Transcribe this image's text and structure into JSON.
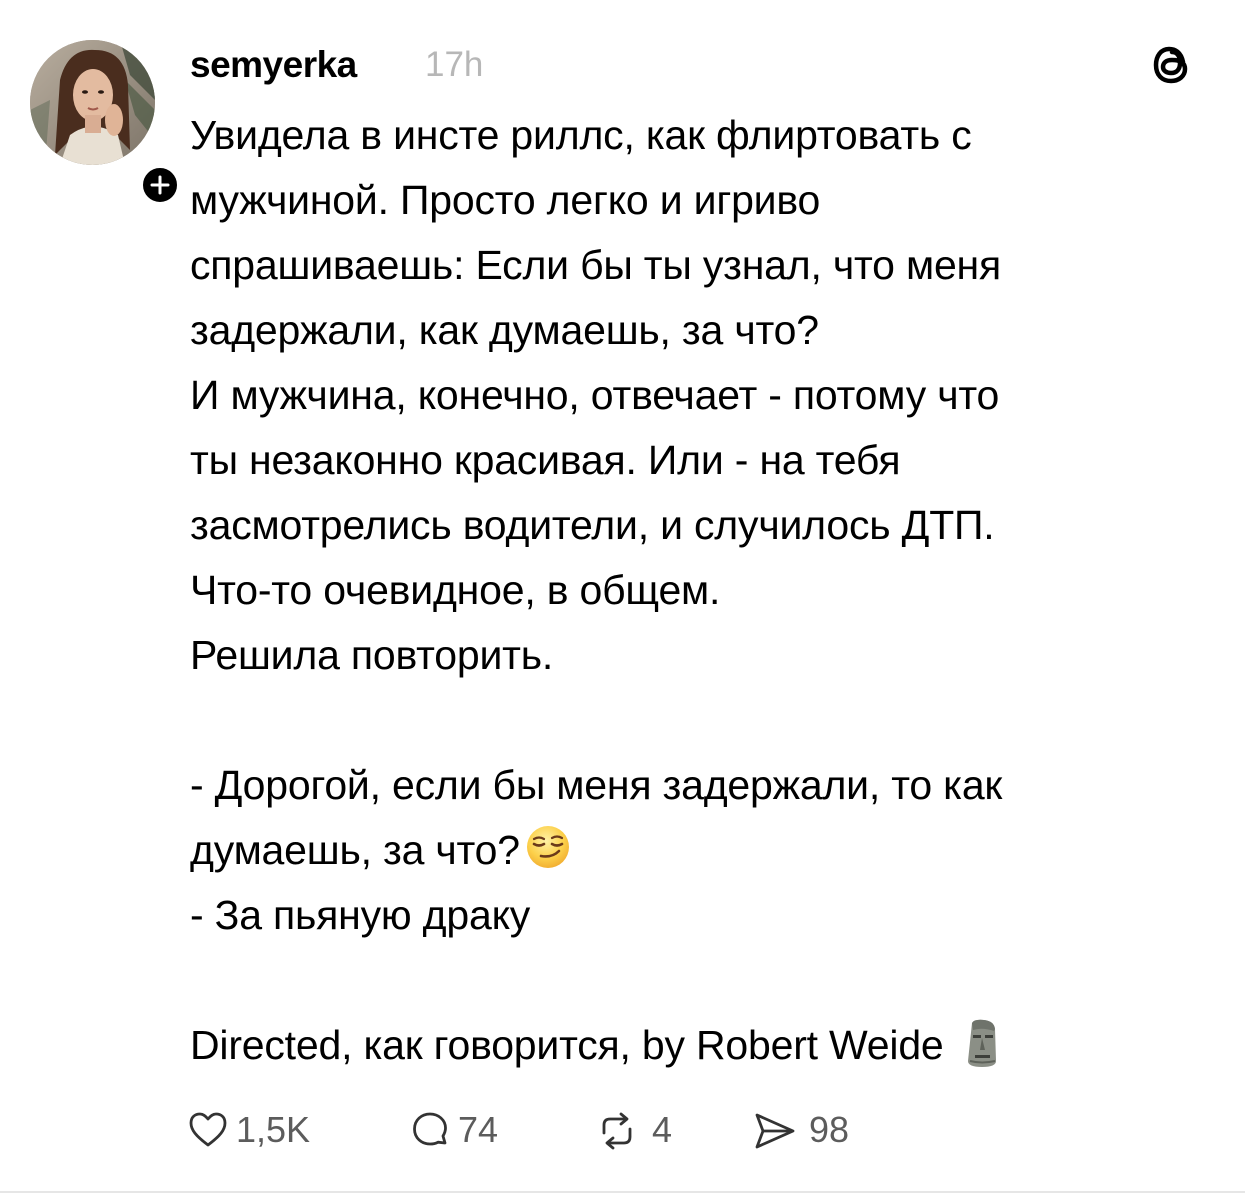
{
  "post": {
    "username": "semyerka",
    "timestamp": "17h",
    "lines": [
      "Увидела в инсте риллс, как флиртовать с",
      "мужчиной. Просто легко и игриво",
      "спрашиваешь: Если бы ты узнал, что меня",
      "задержали, как думаешь, за что?",
      "И мужчина, конечно, отвечает - потому что",
      "ты незаконно красивая. Или - на тебя",
      "засмотрелись водители, и случилось ДТП.",
      "Что-то очевидное, в общем.",
      "Решила повторить.",
      "",
      "- Дорогой, если бы меня задержали, то как",
      "думаешь, за что?",
      "- За пьяную драку",
      "",
      "Directed, как говорится, by Robert Weide"
    ],
    "emoji_line_11": "smirking-face-emoji",
    "emoji_line_14": "moai-emoji"
  },
  "actions": {
    "likes": "1,5K",
    "comments": "74",
    "reposts": "4",
    "shares": "98"
  },
  "icons": {
    "like": "heart-icon",
    "comment": "speech-bubble-icon",
    "repost": "repost-arrows-icon",
    "share": "send-icon",
    "brand": "threads-logo-icon",
    "follow": "plus-icon"
  },
  "colors": {
    "text": "#000000",
    "muted": "#b7b7b7",
    "action_text": "#5c5c5c",
    "divider": "#e6e6e6"
  }
}
